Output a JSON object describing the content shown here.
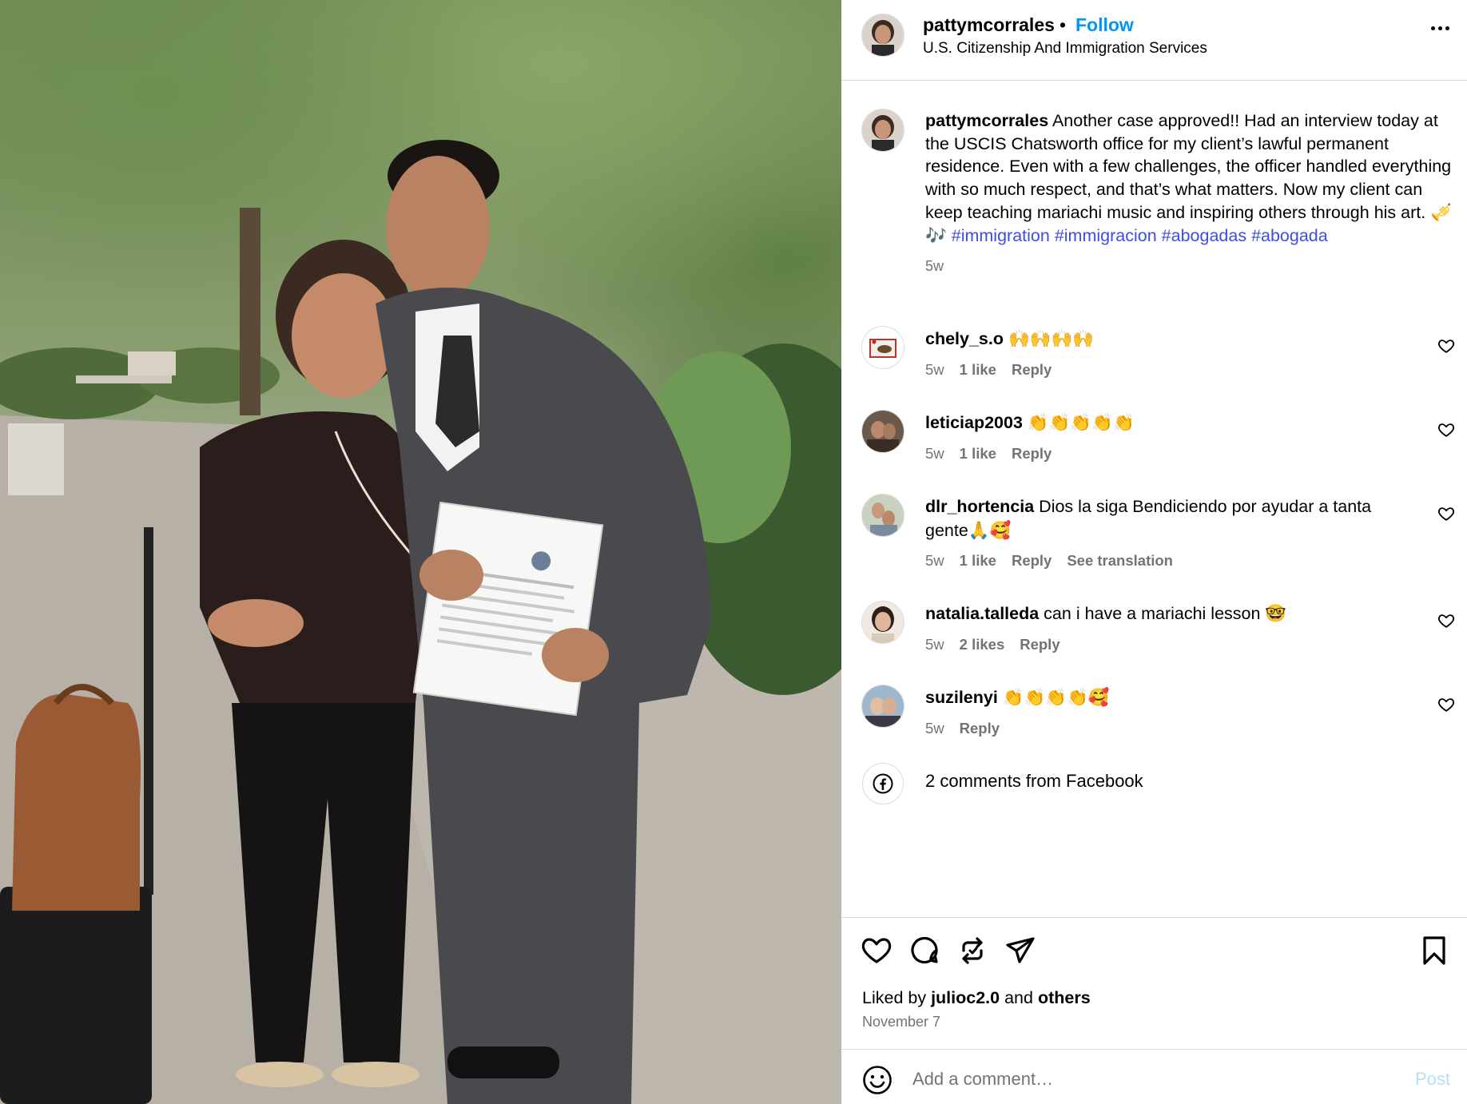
{
  "photo": {
    "alt_icon": "post-photo"
  },
  "header": {
    "username": "pattymcorrales",
    "separator": "•",
    "follow_label": "Follow",
    "location": "U.S. Citizenship And Immigration Services",
    "more_icon": "more-horizontal-icon"
  },
  "caption": {
    "username": "pattymcorrales",
    "text": " Another case approved!! Had an interview today at the USCIS Chatsworth office for my client’s lawful permanent residence. Even with a few challenges, the officer handled everything with so much respect, and that’s what matters. Now my client can keep teaching mariachi music and inspiring others through his art. 🎺🎶 ",
    "hashtags": [
      "#immigration",
      "#immigracion",
      "#abogadas",
      "#abogada"
    ],
    "time": "5w"
  },
  "comments": [
    {
      "username": "chely_s.o",
      "text": " 🙌🙌🙌🙌",
      "time": "5w",
      "likes": "1 like",
      "reply": "Reply",
      "translation": ""
    },
    {
      "username": "leticiap2003",
      "text": " 👏👏👏👏👏",
      "time": "5w",
      "likes": "1 like",
      "reply": "Reply",
      "translation": ""
    },
    {
      "username": "dlr_hortencia",
      "text": " Dios la siga Bendiciendo por ayudar a tanta gente🙏🥰",
      "time": "5w",
      "likes": "1 like",
      "reply": "Reply",
      "translation": "See translation"
    },
    {
      "username": "natalia.talleda",
      "text": " can i have a mariachi lesson 🤓",
      "time": "5w",
      "likes": "2 likes",
      "reply": "Reply",
      "translation": ""
    },
    {
      "username": "suzilenyi",
      "text": " 👏👏👏👏🥰",
      "time": "5w",
      "likes": "",
      "reply": "Reply",
      "translation": ""
    }
  ],
  "facebook": {
    "label": "2 comments from Facebook"
  },
  "actions": {
    "like": "heart-icon",
    "comment": "comment-icon",
    "repost": "repost-icon",
    "share": "share-icon",
    "save": "bookmark-icon"
  },
  "liked_by": {
    "prefix": "Liked by ",
    "user": "julioc2.0",
    "middle": " and ",
    "others": "others"
  },
  "date": "November 7",
  "add_comment": {
    "placeholder": "Add a comment…",
    "post_label": "Post"
  },
  "colors": {
    "link_blue": "#0095f6",
    "hashtag": "#3d4ede",
    "muted": "#737373",
    "divider": "#dbdbdb",
    "post_disabled": "#b2dffc"
  }
}
